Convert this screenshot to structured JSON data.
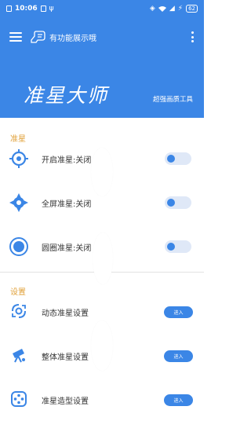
{
  "status_bar": {
    "time": "10:06",
    "battery": "62"
  },
  "toolbar": {
    "feature_text": "有功能展示哦"
  },
  "banner": {
    "title": "准星大师",
    "subtitle": "超强画质工具"
  },
  "sections": {
    "crosshair": {
      "label": "准星"
    },
    "settings": {
      "label": "设置"
    }
  },
  "crosshair_items": [
    {
      "label": "开启准星:关闭",
      "icon": "crosshair-ring-icon",
      "enabled": false
    },
    {
      "label": "全屏准星:关闭",
      "icon": "crosshair-diamond-icon",
      "enabled": false
    },
    {
      "label": "圆圈准星:关闭",
      "icon": "crosshair-circle-icon",
      "enabled": false
    }
  ],
  "settings_items": [
    {
      "label": "动态准星设置",
      "icon": "dynamic-crosshair-icon",
      "button": "进入"
    },
    {
      "label": "整体准星设置",
      "icon": "telescope-icon",
      "button": "进入"
    },
    {
      "label": "准星造型设置",
      "icon": "gamepad-icon",
      "button": "进入"
    }
  ],
  "colors": {
    "primary": "#3b86e6",
    "section_label": "#e0a13a",
    "toggle_track": "#dfe8f7"
  }
}
